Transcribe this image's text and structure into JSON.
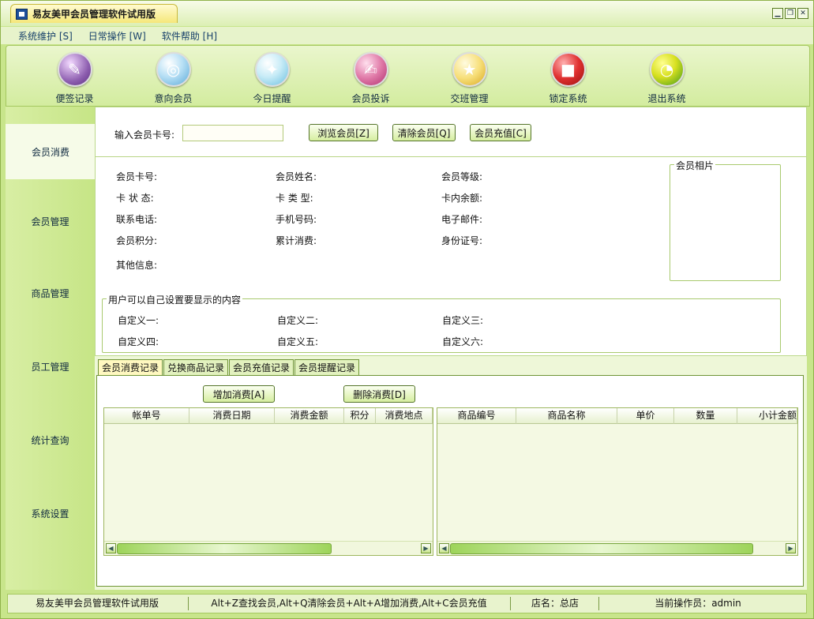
{
  "window": {
    "title": "易友美甲会员管理软件试用版",
    "controls": [
      "minimize",
      "restore",
      "close"
    ]
  },
  "menu": {
    "items": [
      "系统维护 [S]",
      "日常操作 [W]",
      "软件帮助 [H]"
    ]
  },
  "toolbar": {
    "items": [
      {
        "label": "便签记录",
        "icon": "notepad-icon",
        "color": "#8e5fb0"
      },
      {
        "label": "意向会员",
        "icon": "cd-icon",
        "color": "#5aa9d8"
      },
      {
        "label": "今日提醒",
        "icon": "gift-icon",
        "color": "#8fd0e8"
      },
      {
        "label": "会员投诉",
        "icon": "pen-icon",
        "color": "#d85a8c"
      },
      {
        "label": "交班管理",
        "icon": "star-icon",
        "color": "#f0c040"
      },
      {
        "label": "锁定系统",
        "icon": "lock-icon",
        "color": "#d82a2a"
      },
      {
        "label": "退出系统",
        "icon": "exit-icon",
        "color": "#4caa28"
      }
    ]
  },
  "sidebar": {
    "items": [
      "会员消费",
      "会员管理",
      "商品管理",
      "员工管理",
      "统计查询",
      "系统设置"
    ],
    "active": "会员消费"
  },
  "search": {
    "label": "输入会员卡号:",
    "value": "",
    "browse_button": "浏览会员[Z]",
    "clear_button": "清除会员[Q]",
    "recharge_button": "会员充值[C]"
  },
  "member_info": {
    "fields": [
      [
        "会员卡号:",
        "会员姓名:",
        "会员等级:"
      ],
      [
        "卡 状 态:",
        "卡 类 型:",
        "卡内余额:"
      ],
      [
        "联系电话:",
        "手机号码:",
        "电子邮件:"
      ],
      [
        "会员积分:",
        "累计消费:",
        "身份证号:"
      ]
    ],
    "other": "其他信息:",
    "photo_title": "会员相片"
  },
  "custom": {
    "title": "用户可以自己设置要显示的内容",
    "fields": [
      [
        "自定义一:",
        "自定义二:",
        "自定义三:"
      ],
      [
        "自定义四:",
        "自定义五:",
        "自定义六:"
      ]
    ]
  },
  "tabs": {
    "items": [
      "会员消费记录",
      "兑换商品记录",
      "会员充值记录",
      "会员提醒记录"
    ],
    "active": "会员消费记录"
  },
  "consume": {
    "add_button": "增加消费[A]",
    "delete_button": "删除消费[D]",
    "left_columns": [
      "帐单号",
      "消费日期",
      "消费金额",
      "积分",
      "消费地点"
    ],
    "right_columns": [
      "商品编号",
      "商品名称",
      "单价",
      "数量",
      "小计金额"
    ]
  },
  "status": {
    "app": "易友美甲会员管理软件试用版",
    "hotkeys": "Alt+Z查找会员,Alt+Q清除会员+Alt+A增加消费,Alt+C会员充值",
    "store": "店名：总店",
    "operator": "当前操作员：admin"
  }
}
